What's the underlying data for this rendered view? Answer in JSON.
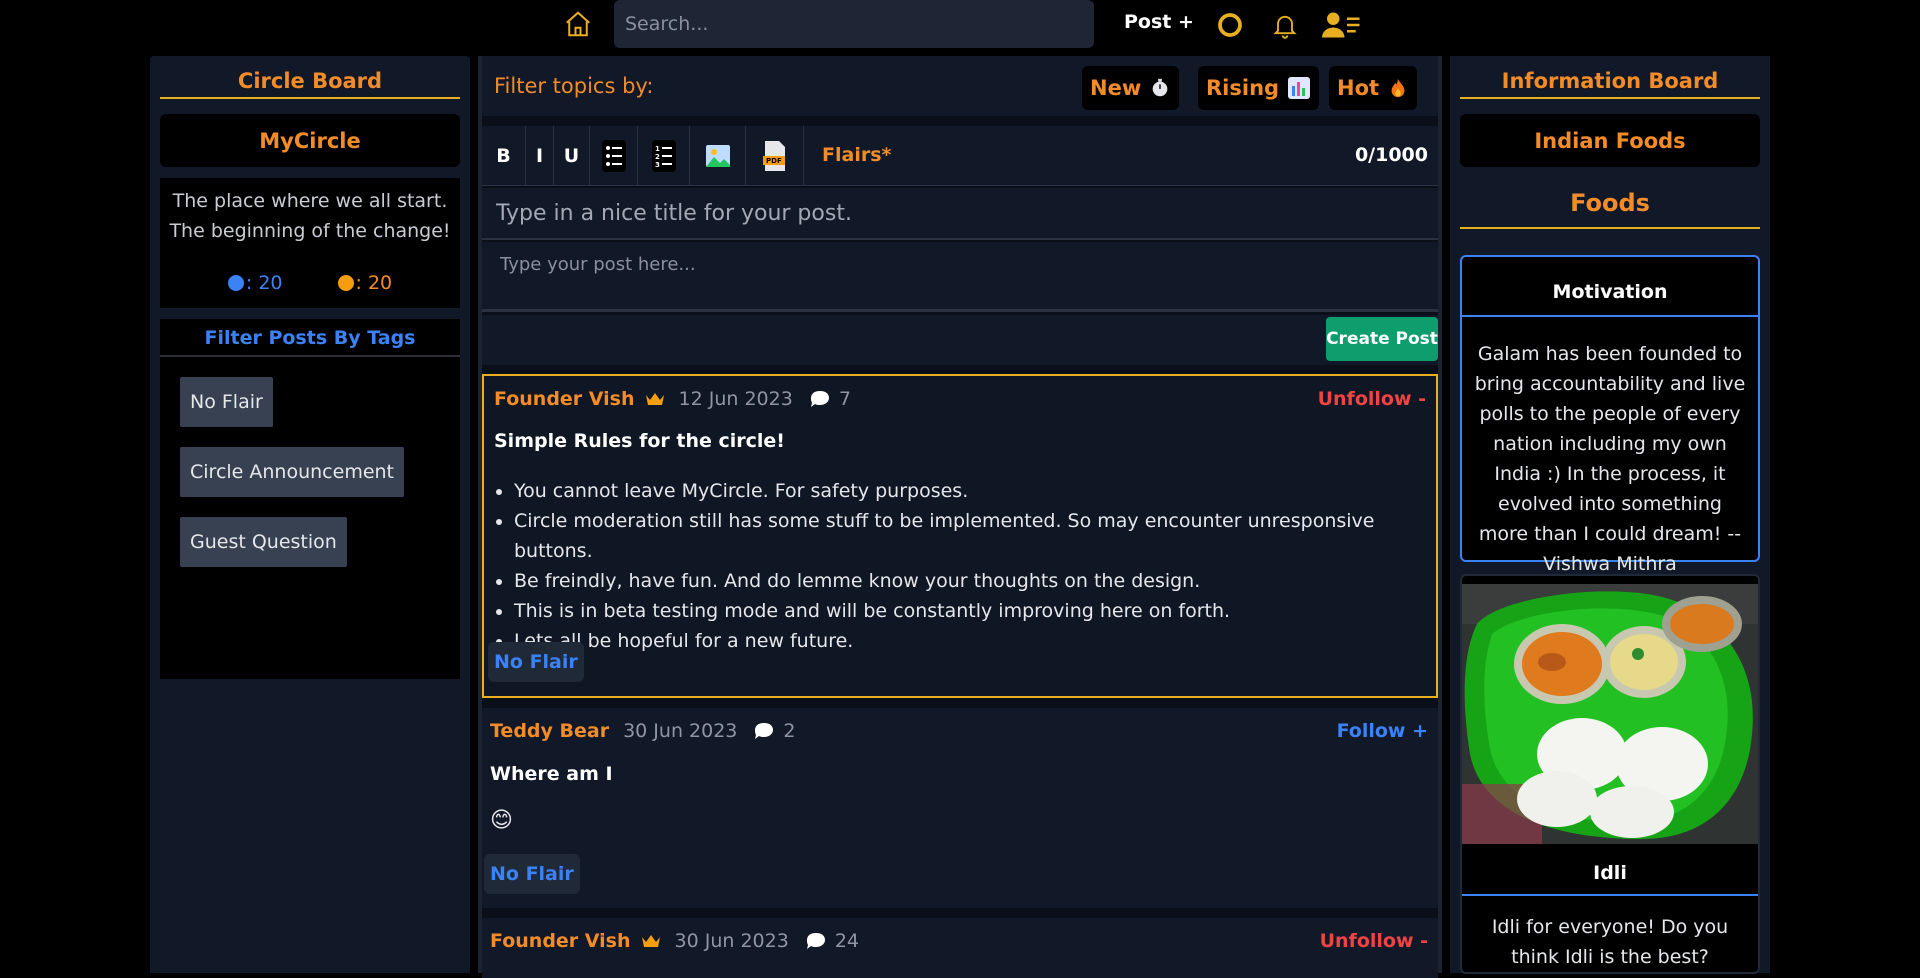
{
  "navbar": {
    "search_placeholder": "Search...",
    "post_label": "Post +",
    "icons": [
      "home-icon",
      "support-icon",
      "bell-icon",
      "user-menu-icon"
    ],
    "accent_color": "#e8b020"
  },
  "left": {
    "title": "Circle Board",
    "circle_name": "MyCircle",
    "desc_line1": "The place where we all start.",
    "desc_line2": "The beginning of the change!",
    "stat_blue": ": 20",
    "stat_orange": ": 20",
    "filter_title": "Filter Posts By Tags",
    "tags": [
      "No Flair",
      "Circle Announcement",
      "Guest Question"
    ]
  },
  "main": {
    "filter_label": "Filter topics by:",
    "sort": {
      "new": "New",
      "rising": "Rising",
      "hot": "Hot"
    },
    "toolbar": {
      "bold": "B",
      "italic": "I",
      "underline": "U",
      "flairs": "Flairs*",
      "count": "0/1000"
    },
    "title_placeholder": "Type in a nice title for your post.",
    "body_placeholder": "Type your post here...",
    "create_label": "Create Post",
    "posts": [
      {
        "author": "Founder Vish",
        "date": "12 Jun 2023",
        "comments": "7",
        "follow": "Unfollow -",
        "title": "Simple Rules for the circle!",
        "bullets": [
          "You cannot leave MyCircle. For safety purposes.",
          "Circle moderation still has some stuff to be implemented. So may encounter unresponsive buttons.",
          "Be freindly, have fun. And do lemme know your thoughts on the design.",
          "This is in beta testing mode and will be constantly improving here on forth.",
          "Lets all be hopeful for a new future."
        ],
        "flair": "No Flair"
      },
      {
        "author": "Teddy Bear",
        "date": "30 Jun 2023",
        "comments": "2",
        "follow": "Follow +",
        "title": "Where am I",
        "body": "😊",
        "flair": "No Flair"
      },
      {
        "author": "Founder Vish",
        "date": "30 Jun 2023",
        "comments": "24",
        "follow": "Unfollow -"
      }
    ]
  },
  "right": {
    "title": "Information Board",
    "board_name": "Indian Foods",
    "section": "Foods",
    "motivation_title": "Motivation",
    "motivation_text": "Galam has been founded to bring accountability and live polls to the people of every nation including my own India :) In the process, it evolved into something more than I could dream! -- Vishwa Mithra",
    "food_name": "Idli",
    "food_desc": "Idli for everyone! Do you think Idli is the best?"
  },
  "colors": {
    "orange": "#f28c28",
    "blue": "#3b82f6",
    "red": "#ef4444",
    "green": "#0e9e6e",
    "gold": "#e8b020"
  }
}
